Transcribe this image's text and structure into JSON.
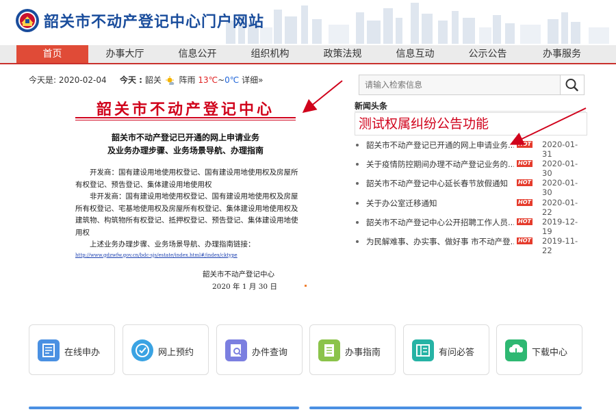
{
  "site": {
    "title": "韶关市不动产登记中心门户网站"
  },
  "nav": {
    "items": [
      "首页",
      "办事大厅",
      "信息公开",
      "组织机构",
      "政策法规",
      "信息互动",
      "公示公告",
      "办事服务"
    ],
    "active": "首页"
  },
  "topbar": {
    "date": "今天是: 2020-02-04",
    "weather_label": "今天 :",
    "city": "韶关",
    "condition": "阵雨",
    "temp_high": "13℃",
    "temp_sep": "~",
    "temp_low": "0℃",
    "detail": "详细»"
  },
  "document": {
    "header": "韶关市不动产登记中心",
    "subtitle_line1": "韶关市不动产登记已开通的网上申请业务",
    "subtitle_line2": "及业务办理步骤、业务场景导航、办理指南",
    "para1": "开发商：国有建设用地使用权登记、国有建设用地使用权及房屋所有权登记、预告登记、集体建设用地使用权",
    "para2": "非开发商：国有建设用地使用权登记、国有建设用地使用权及房屋所有权登记、宅基地使用权及房屋所有权登记、集体建设用地使用权及建筑物、构筑物所有权登记、抵押权登记、预告登记、集体建设用地使用权",
    "para3": "上述业务办理步骤、业务场景导航、办理指南链接：",
    "link": "http://www.gdzwfw.gov.cn/bdc-sjs/estate/index.html#/index/cktype",
    "sign": "韶关市不动产登记中心",
    "sign_date": "2020 年 1 月 30 日"
  },
  "search": {
    "placeholder": "请输入检索信息",
    "icon": "search-icon"
  },
  "news": {
    "heading": "新闻头条",
    "test_banner": "测试权属纠纷公告功能",
    "hot_label": "HOT",
    "items": [
      {
        "title": "韶关市不动产登记已开通的网上申请业务...",
        "date": "2020-01-31"
      },
      {
        "title": "关于疫情防控期间办理不动产登记业务的...",
        "date": "2020-01-30"
      },
      {
        "title": "韶关市不动产登记中心延长春节放假通知",
        "date": "2020-01-30"
      },
      {
        "title": "关于办公室迁移通知",
        "date": "2020-01-22"
      },
      {
        "title": "韶关市不动产登记中心公开招聘工作人员...",
        "date": "2019-12-19"
      },
      {
        "title": "为民解难事、办实事、做好事 市不动产登...",
        "date": "2019-11-22"
      }
    ]
  },
  "services": [
    {
      "label": "在线申办",
      "icon": "online-apply-icon",
      "color": "#4a90e2"
    },
    {
      "label": "网上预约",
      "icon": "appointment-icon",
      "color": "#3aa3e3"
    },
    {
      "label": "办件查询",
      "icon": "query-icon",
      "color": "#7b7fe0"
    },
    {
      "label": "办事指南",
      "icon": "guide-icon",
      "color": "#8bc34a"
    },
    {
      "label": "有问必答",
      "icon": "qa-icon",
      "color": "#26b3a5"
    },
    {
      "label": "下载中心",
      "icon": "download-icon",
      "color": "#2eb872"
    }
  ],
  "colors": {
    "brand": "#1a4d9c",
    "accent": "#e04b37",
    "doc_red": "#d0021b"
  }
}
